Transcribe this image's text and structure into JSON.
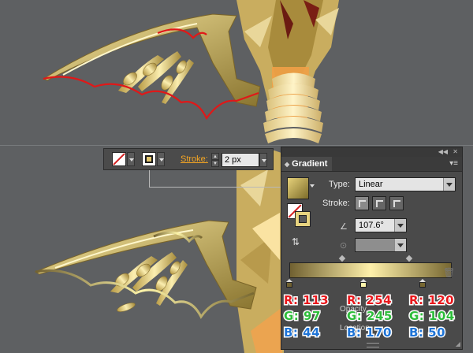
{
  "control_bar": {
    "stroke_label": "Stroke:",
    "stroke_value": "2 px"
  },
  "gradient_panel": {
    "tab_title": "Gradient",
    "type_label": "Type:",
    "type_value": "Linear",
    "stroke_label": "Stroke:",
    "angle_value": "107.6°",
    "aspect_value": "",
    "opacity_label": "Opacity",
    "location_label": "Location"
  },
  "stops": [
    {
      "r": "R: 113",
      "g": "G: 97",
      "b": "B: 44"
    },
    {
      "r": "R: 254",
      "g": "G: 245",
      "b": "B: 170"
    },
    {
      "r": "R: 120",
      "g": "G: 104",
      "b": "B: 50"
    }
  ],
  "colors": {
    "stop1": "#716131",
    "stop2": "#fef5aa",
    "stop3": "#786832",
    "accent_orange": "#f5a623",
    "path_red": "#e01818"
  }
}
